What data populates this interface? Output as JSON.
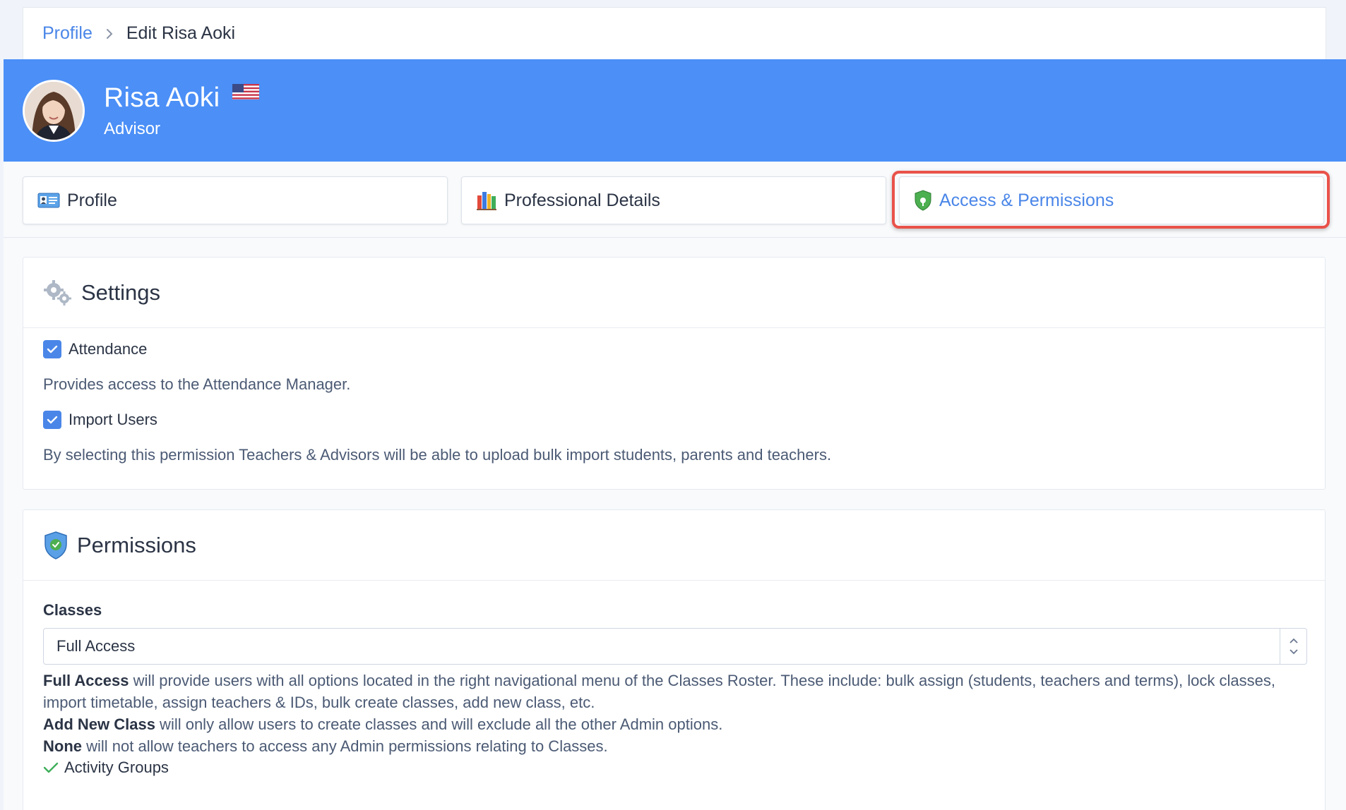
{
  "breadcrumb": {
    "link": "Profile",
    "current": "Edit Risa Aoki"
  },
  "header": {
    "name": "Risa Aoki",
    "role": "Advisor",
    "flag_icon": "us-flag-icon",
    "accent_color": "#4b8ff7"
  },
  "tabs": [
    {
      "label": "Profile",
      "icon": "id-card-icon"
    },
    {
      "label": "Professional Details",
      "icon": "books-icon"
    },
    {
      "label": "Access & Permissions",
      "icon": "shield-icon",
      "active": true
    }
  ],
  "settings": {
    "title": "Settings",
    "items": [
      {
        "label": "Attendance",
        "checked": true,
        "description": "Provides access to the Attendance Manager."
      },
      {
        "label": "Import Users",
        "checked": true,
        "description": "By selecting this permission Teachers & Advisors will be able to upload bulk import students, parents and teachers."
      }
    ]
  },
  "permissions": {
    "title": "Permissions",
    "classes_label": "Classes",
    "classes_value": "Full Access",
    "info": [
      {
        "bold": "Full Access",
        "text": " will provide users with all options located in the right navigational menu of the Classes Roster. These include: bulk assign (students, teachers and terms), lock classes, import timetable, assign teachers & IDs, bulk create classes, add new class, etc."
      },
      {
        "bold": "Add New Class",
        "text": " will only allow users to create classes and will exclude all the other Admin options."
      },
      {
        "bold": "None",
        "text": " will not allow teachers to access any Admin permissions relating to Classes."
      }
    ],
    "next_item": "Activity Groups"
  }
}
